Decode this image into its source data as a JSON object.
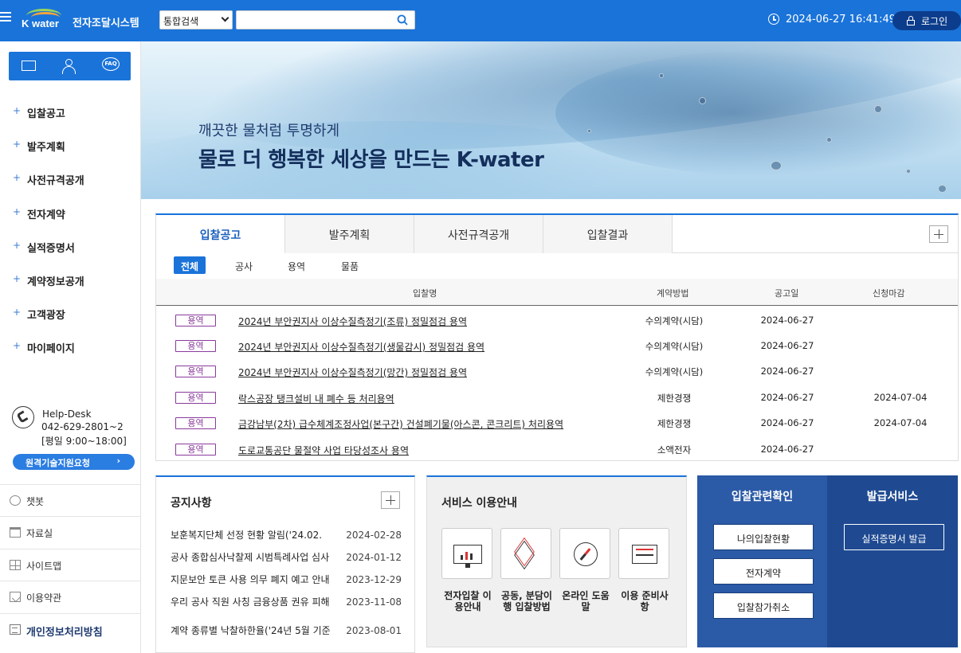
{
  "header": {
    "logo_text": "K water",
    "system_title": "전자조달시스템",
    "search": {
      "scope_selected": "통합검색",
      "placeholder": ""
    },
    "datetime": "2024-06-27 16:41:49",
    "login_label": "로그인"
  },
  "sidebar": {
    "quick_icons": [
      "mail-icon",
      "user-icon",
      "faq-icon"
    ],
    "faq_glyph": "FAQ",
    "nav": [
      {
        "label": "입찰공고"
      },
      {
        "label": "발주계획"
      },
      {
        "label": "사전규격공개"
      },
      {
        "label": "전자계약"
      },
      {
        "label": "실적증명서"
      },
      {
        "label": "계약정보공개"
      },
      {
        "label": "고객광장"
      },
      {
        "label": "마이페이지"
      }
    ],
    "nav_plus": "+",
    "helpdesk": {
      "title": "Help-Desk",
      "phone": "042-629-2801~2",
      "hours": "[평일 9:00~18:00]"
    },
    "remote_support_label": "원격기술지원요청",
    "utility": [
      {
        "label": "챗봇",
        "icon": "chatbot-icon"
      },
      {
        "label": "자료실",
        "icon": "data-room-icon"
      },
      {
        "label": "사이트맵",
        "icon": "sitemap-icon"
      },
      {
        "label": "이용약관",
        "icon": "terms-icon"
      },
      {
        "label": "개인정보처리방침",
        "icon": "privacy-icon"
      }
    ]
  },
  "banner": {
    "subtitle": "깨끗한 물처럼 투명하게",
    "headline": "물로 더 행복한 세상을 만드는 K-water"
  },
  "bid_board": {
    "tabs": [
      "입찰공고",
      "발주계획",
      "사전규격공개",
      "입찰결과"
    ],
    "active_tab": 0,
    "subtabs": [
      "전체",
      "공사",
      "용역",
      "물품"
    ],
    "active_subtab": 0,
    "columns": [
      "입찰명",
      "계약방법",
      "공고일",
      "신청마감"
    ],
    "rows": [
      {
        "type": "용역",
        "title": "2024년 부안권지사 이상수질측정기(조류) 정밀점검 용역",
        "method": "수의계약(시담)",
        "date": "2024-06-27",
        "deadline": ""
      },
      {
        "type": "용역",
        "title": "2024년 부안권지사 이상수질측정기(생물감시) 정밀점검 용역",
        "method": "수의계약(시담)",
        "date": "2024-06-27",
        "deadline": ""
      },
      {
        "type": "용역",
        "title": "2024년 부안권지사 이상수질측정기(망간) 정밀점검 용역",
        "method": "수의계약(시담)",
        "date": "2024-06-27",
        "deadline": ""
      },
      {
        "type": "용역",
        "title": "락스공장 탱크설비 내 폐수 등 처리용역",
        "method": "제한경쟁",
        "date": "2024-06-27",
        "deadline": "2024-07-04"
      },
      {
        "type": "용역",
        "title": "금강남부(2차) 급수체계조정사업(본구간) 건설폐기물(아스콘, 콘크리트) 처리용역",
        "method": "제한경쟁",
        "date": "2024-06-27",
        "deadline": "2024-07-04"
      },
      {
        "type": "용역",
        "title": "도로교통공단 물절약 사업 타당성조사 용역",
        "method": "소액전자",
        "date": "2024-06-27",
        "deadline": ""
      }
    ]
  },
  "notice": {
    "title": "공지사항",
    "items": [
      {
        "title": "보훈복지단체 선정 현황 알림('24.02.",
        "date": "2024-02-28"
      },
      {
        "title": "공사 종합심사낙찰제 시범특례사업 심사",
        "date": "2024-01-12"
      },
      {
        "title": "지문보안 토큰 사용 의무 폐지 예고 안내",
        "date": "2023-12-29"
      },
      {
        "title": "우리 공사 직원 사칭 금융상품 권유 피해",
        "date": "2023-11-08"
      },
      {
        "title": "계약 종류별 낙찰하한율('24년 5월 기준",
        "date": "2023-08-01"
      }
    ]
  },
  "service": {
    "title": "서비스 이용안내",
    "items": [
      {
        "label": "전자입찰 이용안내",
        "icon": "monitor-chart-icon"
      },
      {
        "label": "공동, 분담이행 입찰방법",
        "icon": "layers-icon"
      },
      {
        "label": "온라인 도움말",
        "icon": "compass-icon"
      },
      {
        "label": "이용 준비사항",
        "icon": "tray-icon"
      }
    ]
  },
  "bid_check": {
    "title": "입찰관련확인",
    "buttons": [
      "나의입찰현황",
      "전자계약",
      "입찰참가취소"
    ]
  },
  "issuance": {
    "title": "발급서비스",
    "buttons": [
      "실적증명서 발급"
    ]
  }
}
